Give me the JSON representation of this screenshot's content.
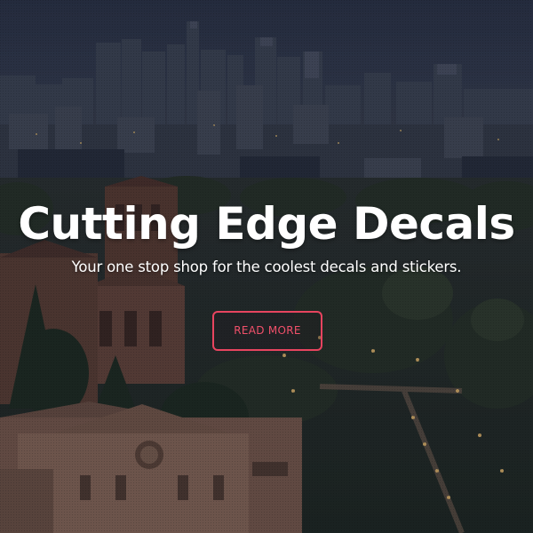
{
  "hero": {
    "title": "Cutting Edge Decals",
    "subtitle": "Your one stop shop for the coolest decals and stickers.",
    "cta_label": "READ MORE"
  },
  "colors": {
    "accent": "#e8445f",
    "text": "#ffffff",
    "sky": "#2b3347"
  }
}
